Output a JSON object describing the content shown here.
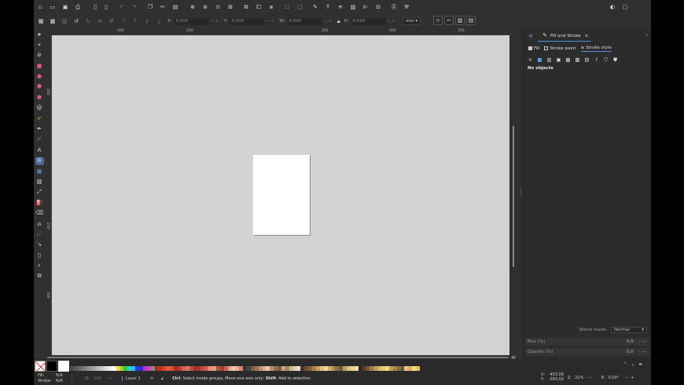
{
  "toolbar": {
    "commands": [
      "new-file",
      "open-file",
      "save",
      "print",
      "import",
      "export",
      "undo",
      "redo",
      "copy",
      "cut",
      "paste",
      "zoom-selection",
      "zoom-drawing",
      "zoom-page",
      "duplicate",
      "clone",
      "unlink-clone",
      "group",
      "ungroup",
      "xml-editor",
      "text-font",
      "layers",
      "objects",
      "align-distribute",
      "preferences",
      "document-properties"
    ]
  },
  "controls": {
    "x_label": "X:",
    "x_value": "0,000",
    "y_label": "Y:",
    "y_value": "0,000",
    "w_label": "W:",
    "w_value": "0,000",
    "h_label": "H:",
    "h_value": "0,000",
    "unit": "mm"
  },
  "ruler": {
    "top": [
      "500",
      "|",
      "250",
      "|",
      "250",
      "|",
      "500",
      "750"
    ],
    "left": [
      "-250",
      "250",
      "500"
    ]
  },
  "dock": {
    "tab_label": "Fill and Stroke",
    "sub_tabs": [
      "Fill",
      "Stroke paint",
      "Stroke style"
    ],
    "no_objects": "No objects",
    "blend_label": "Blend mode:",
    "blend_value": "Normal",
    "blur_label": "Blur (%)",
    "blur_value": "0,0",
    "opacity_label": "Opacity (%)",
    "opacity_value": "0,0"
  },
  "status": {
    "fill_label": "Fill:",
    "fill_value": "N/A",
    "stroke_label": "Stroke:",
    "stroke_value": "N/A",
    "opacity_label": "O:",
    "opacity_value": "100",
    "layer": "Layer 1",
    "message_bold1": "Ctrl",
    "message_1": ": Select inside groups, Move one axis only; ",
    "message_bold2": "Shift",
    "message_2": ": Add to selection",
    "x_label": "X:",
    "x_value": "-453,09",
    "y_label": "Y:",
    "y_value": "-393,02",
    "zoom_label": "Z:",
    "zoom_value": "21%",
    "rotation_label": "R:",
    "rotation_value": "0,00°"
  },
  "palette": [
    "#4a4a4a",
    "#5a5a5a",
    "#6a6a6a",
    "#7a7a7a",
    "#8a8a8a",
    "#9a9a9a",
    "#aaaaaa",
    "#bbbbbb",
    "#cccccc",
    "#dddddd",
    "#eeeeee",
    "#ffffff",
    "#f6d63a",
    "#9bd23a",
    "#35c93a",
    "#2bd6c4",
    "#3ab7f0",
    "#1c3ae8",
    "#3a2bd0",
    "#b03ad6",
    "#e03ab0",
    "#888888",
    "#8a3a20",
    "#c0301c",
    "#d6402a",
    "#e05a3a",
    "#d05030",
    "#c02020",
    "#b04040",
    "#d06050",
    "#e07060",
    "#c04848",
    "#aa3030",
    "#983a2a",
    "#c04a3a",
    "#d85a4a",
    "#e8906a",
    "#d8a08a",
    "#b05040",
    "#a04030",
    "#c86050",
    "#e0a090",
    "#f0c0b0",
    "#e8b0a0",
    "#d88070",
    "#333333",
    "#444444",
    "#805a40",
    "#a07050",
    "#c09070",
    "#d8b090",
    "#e8c8a8",
    "#b89070",
    "#987050",
    "#786040",
    "#c0a080",
    "#a08860",
    "#d0b890",
    "#e8d0a8",
    "#f0e0c0",
    "#3a3a3a",
    "#6a4a30",
    "#8a6040",
    "#aa8050",
    "#c8a060",
    "#e0c080",
    "#f0d890",
    "#c8b070",
    "#a89050",
    "#887040",
    "#686040",
    "#b8a060",
    "#d8c080",
    "#e8d090",
    "#f0e0a0",
    "#2a2a2a",
    "#5a4030",
    "#7a5a38",
    "#9a7848",
    "#ba9858",
    "#d8b868",
    "#e8c870",
    "#f0d880",
    "#c0a050",
    "#a08040",
    "#807040",
    "#605838",
    "#f0c080",
    "#e0b070",
    "#f4e070",
    "#e8c060"
  ]
}
